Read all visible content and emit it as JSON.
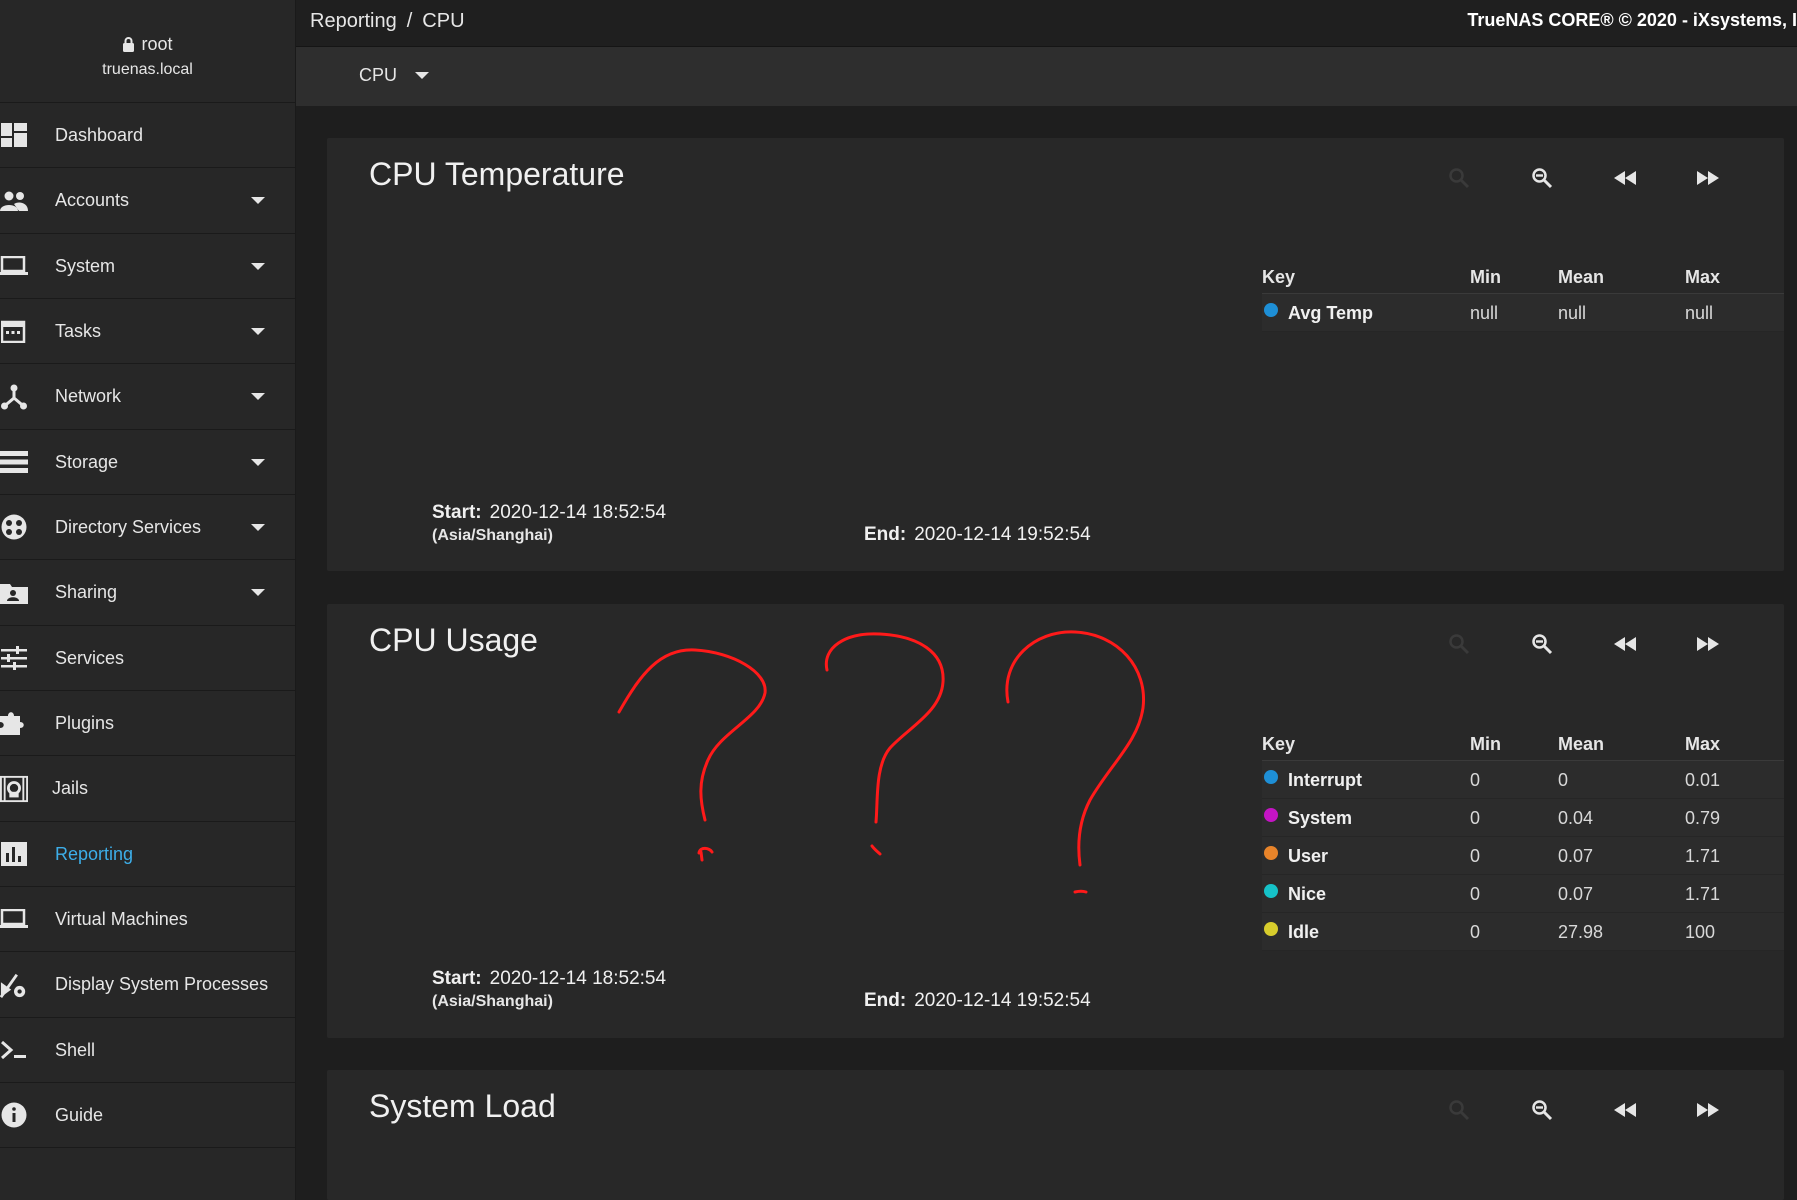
{
  "user": {
    "name": "root",
    "host": "truenas.local"
  },
  "sidebar": {
    "items": [
      {
        "label": "Dashboard",
        "icon": "dashboard-icon"
      },
      {
        "label": "Accounts",
        "icon": "people-icon"
      },
      {
        "label": "System",
        "icon": "laptop-icon"
      },
      {
        "label": "Tasks",
        "icon": "calendar-icon"
      },
      {
        "label": "Network",
        "icon": "network-icon"
      },
      {
        "label": "Storage",
        "icon": "storage-icon"
      },
      {
        "label": "Directory Services",
        "icon": "directory-icon"
      },
      {
        "label": "Sharing",
        "icon": "share-folder-icon"
      },
      {
        "label": "Services",
        "icon": "sliders-icon"
      },
      {
        "label": "Plugins",
        "icon": "puzzle-icon"
      },
      {
        "label": "Jails",
        "icon": "jail-icon"
      },
      {
        "label": "Reporting",
        "icon": "bar-chart-icon"
      },
      {
        "label": "Virtual Machines",
        "icon": "monitor-icon"
      },
      {
        "label": "Display System Processes",
        "icon": "process-icon"
      },
      {
        "label": "Shell",
        "icon": "terminal-icon"
      },
      {
        "label": "Guide",
        "icon": "info-icon"
      }
    ],
    "active": "Reporting"
  },
  "header": {
    "crumb_parent": "Reporting",
    "crumb_sep": "/",
    "crumb_current": "CPU",
    "copyright": "TrueNAS CORE® © 2020 - iXsystems, I"
  },
  "selector": {
    "value": "CPU"
  },
  "legend_headers": {
    "key": "Key",
    "min": "Min",
    "mean": "Mean",
    "max": "Max"
  },
  "range_labels": {
    "start": "Start:",
    "end": "End:",
    "tz": "(Asia/Shanghai)"
  },
  "cards": {
    "temperature": {
      "title": "CPU Temperature",
      "start": "2020-12-14 18:52:54",
      "end": "2020-12-14 19:52:54",
      "rows": [
        {
          "name": "Avg Temp",
          "color": "#1e8fd6",
          "min": "null",
          "mean": "null",
          "max": "null"
        }
      ]
    },
    "usage": {
      "title": "CPU Usage",
      "start": "2020-12-14 18:52:54",
      "end": "2020-12-14 19:52:54",
      "rows": [
        {
          "name": "Interrupt",
          "color": "#1e8fd6",
          "min": "0",
          "mean": "0",
          "max": "0.01"
        },
        {
          "name": "System",
          "color": "#c414c4",
          "min": "0",
          "mean": "0.04",
          "max": "0.79"
        },
        {
          "name": "User",
          "color": "#e8842a",
          "min": "0",
          "mean": "0.07",
          "max": "1.71"
        },
        {
          "name": "Nice",
          "color": "#16c2c8",
          "min": "0",
          "mean": "0.07",
          "max": "1.71"
        },
        {
          "name": "Idle",
          "color": "#d7cc2c",
          "min": "0",
          "mean": "27.98",
          "max": "100"
        }
      ]
    },
    "load": {
      "title": "System Load"
    }
  },
  "colors": {
    "accent": "#3daee9",
    "annotation": "#ff1a1a"
  }
}
